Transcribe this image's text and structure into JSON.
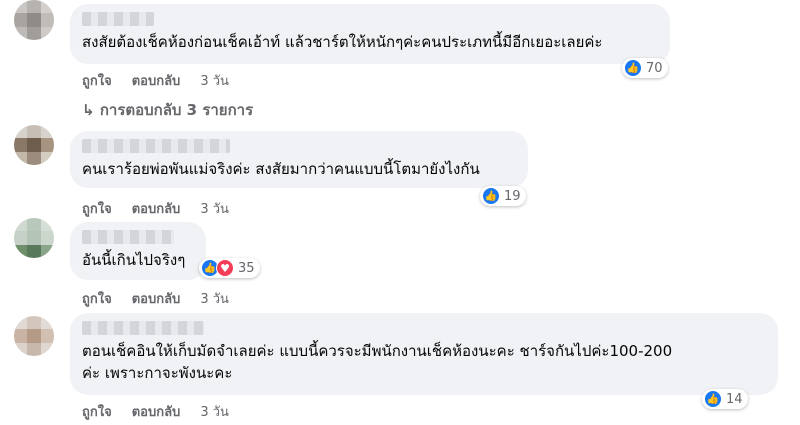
{
  "comments": [
    {
      "text": "สงสัยต้องเช็คห้องก่อนเช็คเอ้าท์ แล้วชาร์ตให้หนักๆค่ะคนประเภทนี้มีอีกเยอะเลยค่ะ",
      "like_label": "ถูกใจ",
      "reply_label": "ตอบกลับ",
      "time": "3 วัน",
      "reaction_count": "70",
      "reaction_icons": [
        "like-icon"
      ]
    },
    {
      "text": "คนเราร้อยพ่อพันแม่จริงค่ะ สงสัยมากว่าคนแบบนี้โตมายังไงกัน",
      "like_label": "ถูกใจ",
      "reply_label": "ตอบกลับ",
      "time": "3 วัน",
      "reaction_count": "19",
      "reaction_icons": [
        "like-icon"
      ]
    },
    {
      "text": "อันนี้เกินไปจริงๆ",
      "like_label": "ถูกใจ",
      "reply_label": "ตอบกลับ",
      "time": "3 วัน",
      "reaction_count": "35",
      "reaction_icons": [
        "like-icon",
        "love-icon"
      ]
    },
    {
      "text_line1": "ตอนเช็คอินให้เก็บมัดจำเลยค่ะ แบบนี้ควรจะมีพนักงานเช็คห้องนะคะ ชาร์จกันไปค่ะ100-200",
      "text_line2": "ค่ะ เพราะกาจะพังนะคะ",
      "like_label": "ถูกใจ",
      "reply_label": "ตอบกลับ",
      "time": "3 วัน",
      "reaction_count": "14",
      "reaction_icons": [
        "like-icon"
      ]
    }
  ],
  "replies_link": "การตอบกลับ 3 รายการ",
  "colors": {
    "bubble": "#f0f2f5",
    "like": "#1877f2",
    "love": "#f33e58",
    "meta": "#65676b"
  }
}
